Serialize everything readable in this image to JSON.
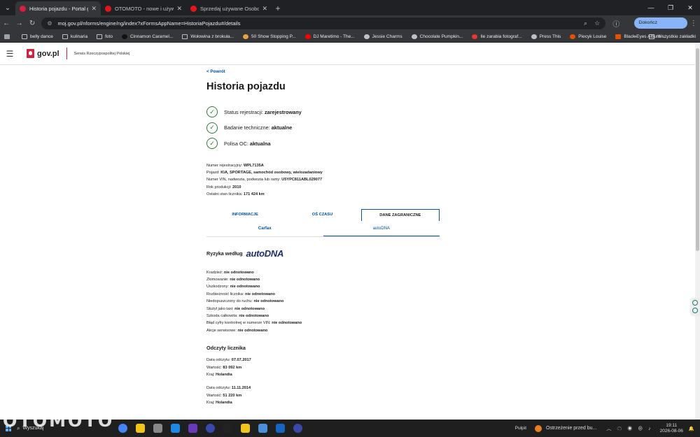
{
  "browser": {
    "tabs": [
      {
        "title": "Historia pojazdu - Portal gov.pl",
        "color": "#d4213d",
        "active": true
      },
      {
        "title": "OTOMOTO - nowe i używane sa",
        "color": "#e4161c",
        "active": false
      },
      {
        "title": "Sprzedaj używane Osobowe | O",
        "color": "#e4161c",
        "active": false
      }
    ],
    "url": "moj.gov.pl/nforms/engine/ng/index?xFormsAppName=HistoriaPojazdu#/details",
    "update_button": "Dokończ aktualizację",
    "bookmarks": [
      "belly dance",
      "kulinaria",
      "foto",
      "Cinnamon Caramel...",
      "Wołowina z brokuła...",
      "50 Show Stopping P...",
      "DJ Maretimo - The...",
      "Jessie Charms",
      "Chocolate Pumpkin...",
      "Ile zarabia fotograf...",
      "Press This",
      "Piecyk Louise",
      "Black Eyes Album -..."
    ],
    "all_bookmarks": "Wszystkie zakładki"
  },
  "header": {
    "logo_text": "gov.pl",
    "subtitle": "Serwis Rzeczypospolitej Polskiej"
  },
  "page": {
    "back_link": "< Powrót",
    "title": "Historia pojazdu",
    "statuses": [
      {
        "label": "Status rejestracji:",
        "value": "zarejestrowany"
      },
      {
        "label": "Badanie techniczne:",
        "value": "aktualne"
      },
      {
        "label": "Polisa OC:",
        "value": "aktualna"
      }
    ],
    "details": [
      {
        "label": "Numer rejestracyjny:",
        "value": "WPL7135A"
      },
      {
        "label": "Pojazd:",
        "value": "KIA, SPORTAGE, samochód osobowy, wielozadaniowy"
      },
      {
        "label": "Numer VIN, nadwozia, podwozia lub ramy:",
        "value": "U5YPC811ABL029077"
      },
      {
        "label": "Rok produkcji:",
        "value": "2010"
      },
      {
        "label": "Ostatni stan licznika:",
        "value": "171 424 km"
      }
    ],
    "tabs": [
      "INFORMACJE",
      "OŚ CZASU",
      "DANE ZAGRANICZNE"
    ],
    "subtabs": [
      "Carfax",
      "autoDNA"
    ],
    "risk_title": "Ryzyka według",
    "risk_brand": "autoDNA",
    "risks": [
      {
        "label": "Kradzież:",
        "value": "nie odnotowano"
      },
      {
        "label": "Złomowanie:",
        "value": "nie odnotowano"
      },
      {
        "label": "Uszkodzony:",
        "value": "nie odnotowano"
      },
      {
        "label": "Rozbieżność licznika:",
        "value": "nie odnotowano"
      },
      {
        "label": "Niedopuszczony do ruchu:",
        "value": "nie odnotowano"
      },
      {
        "label": "Służył jako taxi:",
        "value": "nie odnotowano"
      },
      {
        "label": "Szkoda całkowita:",
        "value": "nie odnotowano"
      },
      {
        "label": "Błąd cyfry kontrolnej w numerze VIN:",
        "value": "nie odnotowano"
      },
      {
        "label": "Akcje serwisowe:",
        "value": "nie odnotowano"
      }
    ],
    "odometer_title": "Odczyty licznika",
    "readings": [
      {
        "date_label": "Data odczytu:",
        "date": "07.07.2017",
        "value_label": "Wartość:",
        "value": "83 092 km",
        "country_label": "Kraj:",
        "country": "Holandia"
      },
      {
        "date_label": "Data odczytu:",
        "date": "11.11.2014",
        "value_label": "Wartość:",
        "value": "51 220 km",
        "country_label": "Kraj:",
        "country": "Holandia"
      }
    ]
  },
  "taskbar": {
    "watermark": "OTOMOTO",
    "search": "Wyszukaj",
    "pulpit": "Pulpit",
    "notification": "Ostrzeżenie przed bu...",
    "time": "19:11",
    "date": "2026-08-06"
  }
}
